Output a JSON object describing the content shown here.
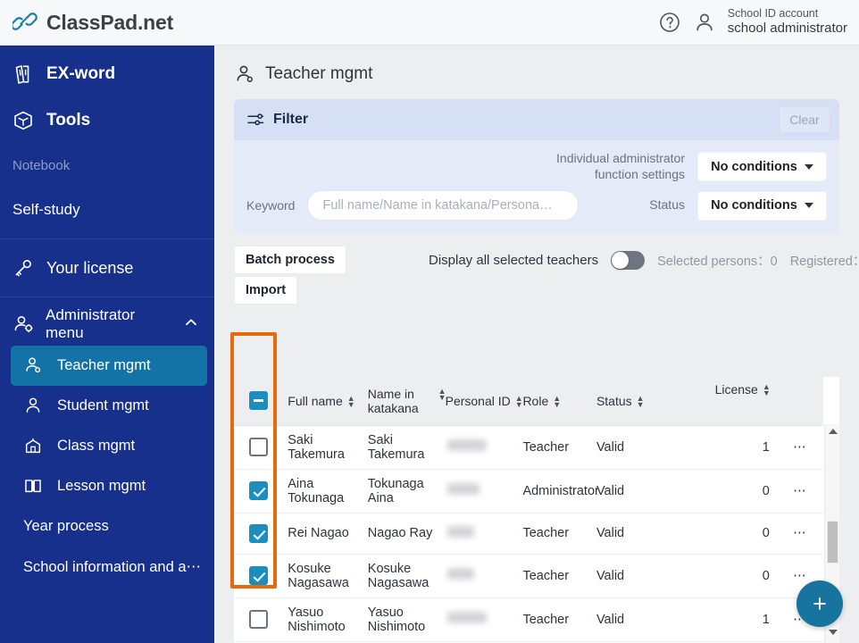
{
  "brand": {
    "name": "ClassPad.net",
    "logo_icon": "link-chain-icon"
  },
  "header": {
    "help_icon": "help-circle-icon",
    "user_icon": "user-icon",
    "account_label": "School ID account",
    "account_name": "school administrator"
  },
  "sidebar": {
    "items": [
      {
        "label": "EX-word",
        "icon": "book-dictionary-icon"
      },
      {
        "label": "Tools",
        "icon": "toolbox-icon"
      },
      {
        "label": "Notebook",
        "icon": ""
      },
      {
        "label": "Self-study",
        "icon": ""
      },
      {
        "label": "Your license",
        "icon": "key-icon"
      }
    ],
    "admin_group": {
      "label": "Administrator menu",
      "icon": "user-gear-icon",
      "chevron": "chevron-up-icon"
    },
    "admin_items": [
      {
        "label": "Teacher mgmt",
        "icon": "teacher-icon",
        "active": true
      },
      {
        "label": "Student mgmt",
        "icon": "student-icon",
        "active": false
      },
      {
        "label": "Class mgmt",
        "icon": "class-icon",
        "active": false
      },
      {
        "label": "Lesson mgmt",
        "icon": "book-open-icon",
        "active": false
      }
    ],
    "plain_items": [
      {
        "label": "Year process"
      },
      {
        "label": "School information and a⋯"
      }
    ],
    "active_color": "#1473a6",
    "bg_color": "#16308c"
  },
  "main": {
    "page_title": "Teacher mgmt",
    "page_title_icon": "teacher-icon",
    "filter": {
      "title": "Filter",
      "icon": "sliders-icon",
      "clear_label": "Clear",
      "admin_fn_label": "Individual administrator function settings",
      "admin_fn_value": "No conditions",
      "keyword_label": "Keyword",
      "keyword_value": "",
      "keyword_placeholder": "Full name/Name in katakana/Persona…",
      "status_label": "Status",
      "status_value": "No conditions"
    },
    "toolbar": {
      "batch_label": "Batch process",
      "import_label": "Import",
      "display_all_label": "Display all selected teachers",
      "display_all_on": false,
      "selected_persons": "Selected persons：0",
      "registered": "Registered："
    },
    "table": {
      "columns": [
        {
          "key": "check",
          "label": "",
          "sortable": false
        },
        {
          "key": "full_name",
          "label": "Full name",
          "sortable": true
        },
        {
          "key": "kana",
          "label": "Name in katakana",
          "sortable": true
        },
        {
          "key": "personal_id",
          "label": "Personal ID",
          "sortable": true
        },
        {
          "key": "role",
          "label": "Role",
          "sortable": true
        },
        {
          "key": "status",
          "label": "Status",
          "sortable": true
        },
        {
          "key": "license",
          "label": "License",
          "sortable": true
        },
        {
          "key": "menu",
          "label": "",
          "sortable": false
        }
      ],
      "header_checkbox": "indeterminate",
      "rows": [
        {
          "checked": false,
          "full_name": "Saki Takemura",
          "kana": "Saki Takemura",
          "personal_id": "",
          "role": "Teacher",
          "status": "Valid",
          "license": "1",
          "menu": "…"
        },
        {
          "checked": true,
          "full_name": "Aina Tokunaga",
          "kana": "Tokunaga Aina",
          "personal_id": "",
          "role": "Administrator",
          "status": "Valid",
          "license": "0",
          "menu": "…"
        },
        {
          "checked": true,
          "full_name": "Rei Nagao",
          "kana": "Nagao Ray",
          "personal_id": "",
          "role": "Teacher",
          "status": "Valid",
          "license": "0",
          "menu": "…"
        },
        {
          "checked": true,
          "full_name": "Kosuke Nagasawa",
          "kana": "Kosuke Nagasawa",
          "personal_id": "",
          "role": "Teacher",
          "status": "Valid",
          "license": "0",
          "menu": "…"
        },
        {
          "checked": false,
          "full_name": "Yasuo Nishimoto",
          "kana": "Yasuo Nishimoto",
          "personal_id": "",
          "role": "Teacher",
          "status": "Valid",
          "license": "1",
          "menu": "…"
        }
      ]
    },
    "highlight_color": "#e8690b",
    "fab": {
      "label": "+",
      "icon": "plus-icon",
      "color": "#16749f"
    }
  }
}
